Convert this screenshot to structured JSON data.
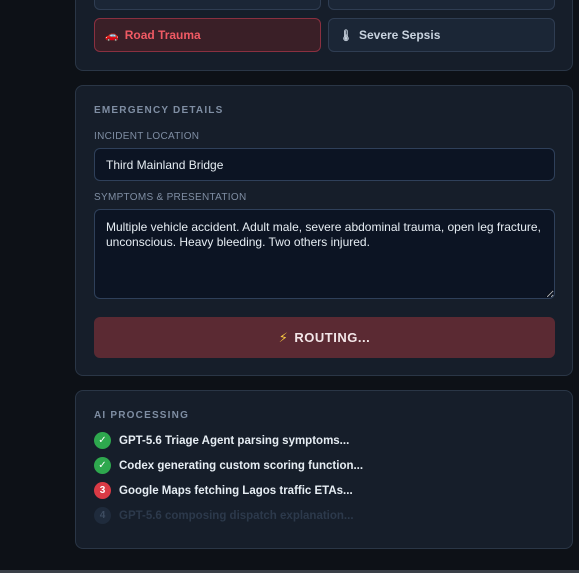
{
  "incident_types": {
    "road_trauma": {
      "label": "Road Trauma",
      "icon": "car-icon",
      "glyph": "🚗",
      "selected": true
    },
    "severe_sepsis": {
      "label": "Severe Sepsis",
      "icon": "thermometer-icon",
      "glyph": "🌡",
      "selected": false
    }
  },
  "emergency_details": {
    "section_title": "EMERGENCY DETAILS",
    "location_label": "INCIDENT LOCATION",
    "location_value": "Third Mainland Bridge",
    "symptoms_label": "SYMPTOMS & PRESENTATION",
    "symptoms_value": "Multiple vehicle accident. Adult male, severe abdominal trauma, open leg fracture, unconscious. Heavy bleeding. Two others injured.",
    "route_button": {
      "icon": "lightning-icon",
      "glyph": "⚡",
      "label": "ROUTING..."
    }
  },
  "ai_processing": {
    "section_title": "AI PROCESSING",
    "steps": [
      {
        "status": "done",
        "badge": "✓",
        "text": "GPT-5.6 Triage Agent parsing symptoms..."
      },
      {
        "status": "done",
        "badge": "✓",
        "text": "Codex generating custom scoring function..."
      },
      {
        "status": "active",
        "badge": "3",
        "text": "Google Maps fetching Lagos traffic ETAs..."
      },
      {
        "status": "pending",
        "badge": "4",
        "text": "GPT-5.6 composing dispatch explanation..."
      }
    ]
  },
  "colors": {
    "accent_red": "#f05a64",
    "success_green": "#2ea84e",
    "active_red": "#d93a45",
    "panel_bg": "#161e2a"
  }
}
